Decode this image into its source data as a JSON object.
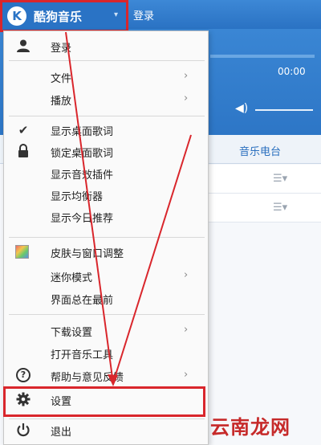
{
  "app": {
    "title": "酷狗音乐",
    "logo_letter": "K",
    "caret": "▾",
    "titlebar_login": "登录"
  },
  "player": {
    "time": "00:00",
    "tab_radio": "音乐电台"
  },
  "menu": {
    "items": [
      {
        "label": "登录",
        "icon": "user-icon"
      },
      {
        "label": "文件",
        "submenu": true
      },
      {
        "label": "播放",
        "submenu": true
      },
      {
        "label": "显示桌面歌词",
        "icon": "check-icon",
        "checked": true
      },
      {
        "label": "锁定桌面歌词",
        "icon": "lock-icon"
      },
      {
        "label": "显示音效插件"
      },
      {
        "label": "显示均衡器"
      },
      {
        "label": "显示今日推荐"
      },
      {
        "label": "皮肤与窗口调整",
        "icon": "palette-icon"
      },
      {
        "label": "迷你模式",
        "submenu": true
      },
      {
        "label": "界面总在最前"
      },
      {
        "label": "下载设置",
        "submenu": true
      },
      {
        "label": "打开音乐工具"
      },
      {
        "label": "帮助与意见反馈",
        "icon": "help-icon",
        "submenu": true
      },
      {
        "label": "设置",
        "icon": "gear-icon"
      },
      {
        "label": "退出",
        "icon": "power-icon"
      }
    ]
  },
  "watermark": "云南龙网",
  "colors": {
    "accent_blue": "#2a73c5",
    "highlight_red": "#d9262c"
  }
}
